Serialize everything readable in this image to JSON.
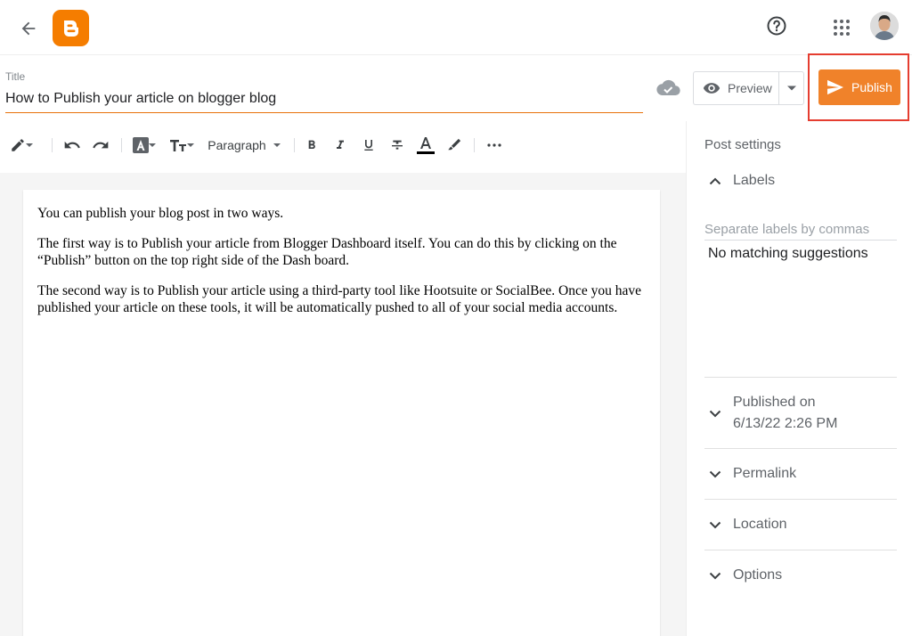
{
  "header": {
    "back_icon": "arrow-left-icon",
    "logo_icon": "blogger-logo-icon",
    "help_icon": "help-circle-icon",
    "apps_icon": "apps-grid-icon"
  },
  "editor_top": {
    "title_label": "Title",
    "title_value": "How to Publish your article on blogger blog",
    "preview_label": "Preview",
    "publish_label": "Publish"
  },
  "toolbar": {
    "paragraph_label": "Paragraph",
    "text_color": "#000000"
  },
  "content": {
    "paragraphs": [
      " You can publish your blog post in two ways.",
      "The first way is to Publish your article from Blogger Dashboard itself. You can do this by clicking on the “Publish” button on the top right side of the Dash board.",
      "The second way is to Publish your article using a third-party tool like Hootsuite or SocialBee. Once you have published your article on these tools, it will be automatically pushed to all of your social media accounts."
    ]
  },
  "sidebar": {
    "title": "Post settings",
    "labels": {
      "heading": "Labels",
      "placeholder": "Separate labels by commas",
      "suggestion_text": "No matching suggestions"
    },
    "published": {
      "heading": "Published on",
      "value": "6/13/22 2:26 PM"
    },
    "permalink": "Permalink",
    "location": "Location",
    "options": "Options"
  },
  "colors": {
    "accent": "#f0822a",
    "brand": "#f57d00",
    "highlight": "#e53d30"
  }
}
